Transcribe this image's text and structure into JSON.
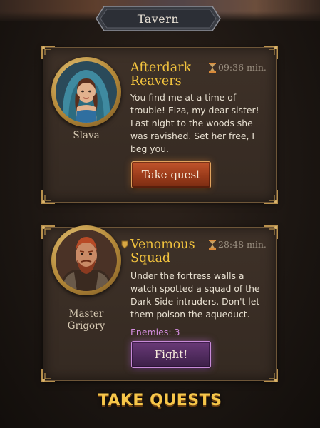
{
  "header": {
    "title": "Tavern"
  },
  "quests": [
    {
      "npc_name": "Slava",
      "title": "Afterdark Reavers",
      "timer": "09:36 min.",
      "description": "You find me at a time of trouble! Elza, my dear sister! Last night to the woods she was ravished. Set her free, I beg you.",
      "action_label": "Take quest"
    },
    {
      "npc_name": "Master Grigory",
      "title": "Venomous Squad",
      "timer": "28:48 min.",
      "description": "Under the fortress walls a watch spotted a squad of the Dark Side intruders. Don't let them poison the aqueduct.",
      "enemies_label": "Enemies: 3",
      "action_label": "Fight!"
    }
  ],
  "footer": {
    "caption": "TAKE QUESTS"
  },
  "colors": {
    "quest_title": "#f3c43e",
    "take_quest_button": "#9a3b1a",
    "fight_button": "#4e2a5c",
    "enemies_text": "#d48ee0",
    "caption": "#f6c64a"
  }
}
